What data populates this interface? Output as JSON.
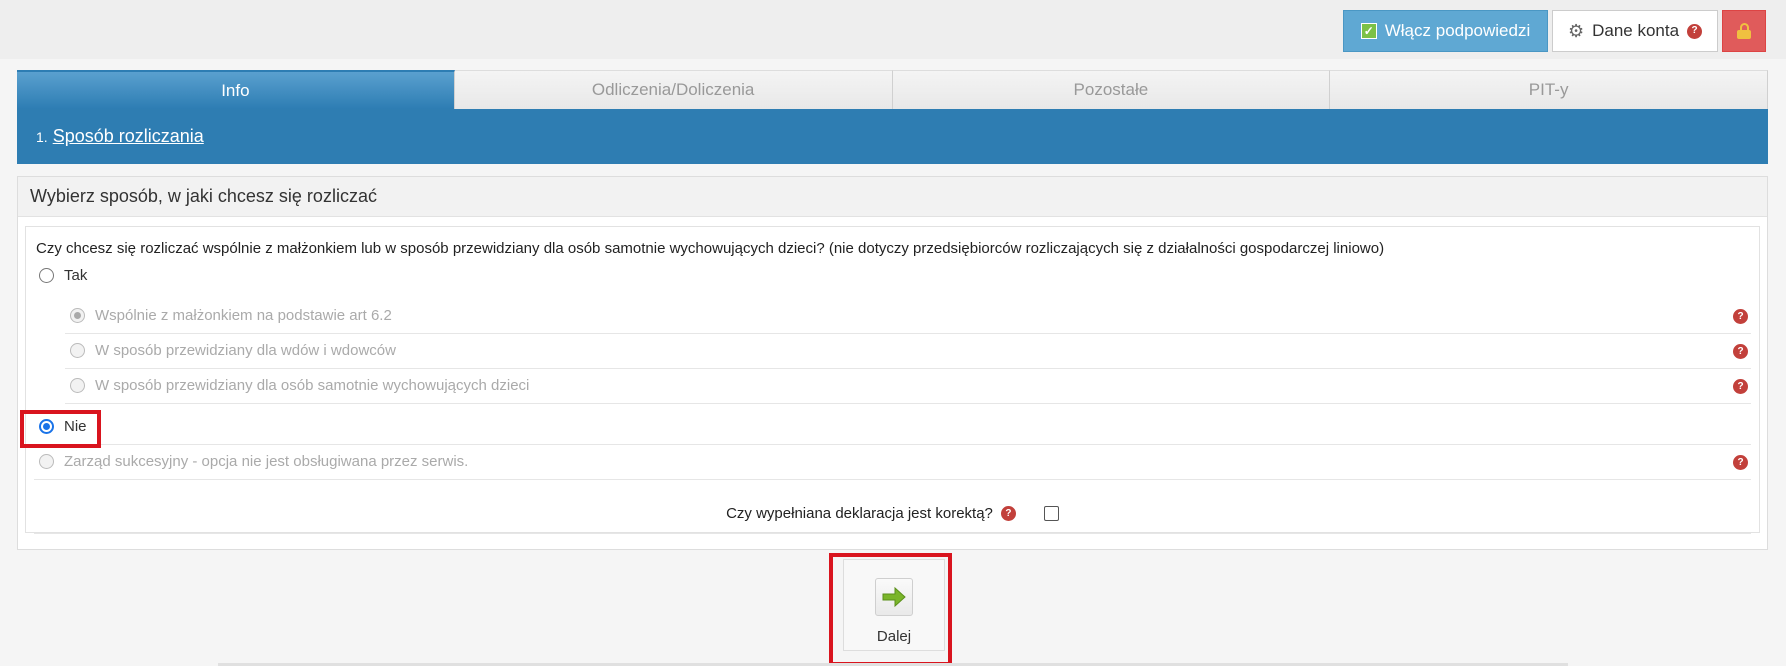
{
  "toolbar": {
    "hints_label": "Włącz podpowiedzi",
    "account_label": "Dane konta"
  },
  "tabs": [
    {
      "label": "Info"
    },
    {
      "label": "Odliczenia/Doliczenia"
    },
    {
      "label": "Pozostałe"
    },
    {
      "label": "PIT-y"
    }
  ],
  "step": {
    "number": "1.",
    "label": "Sposób rozliczania"
  },
  "panel": {
    "title": "Wybierz sposób, w jaki chcesz się rozliczać",
    "question": "Czy chcesz się rozliczać wspólnie z małżonkiem lub w sposób przewidziany dla osób samotnie wychowujących dzieci? (nie dotyczy przedsiębiorców rozliczających się z działalności gospodarczej liniowo)",
    "option_yes": "Tak",
    "sub_options": [
      {
        "label": "Wspólnie z małżonkiem na podstawie art 6.2"
      },
      {
        "label": "W sposób przewidziany dla wdów i wdowców"
      },
      {
        "label": "W sposób przewidziany dla osób samotnie wychowujących dzieci"
      }
    ],
    "option_no": "Nie",
    "option_succession": "Zarząd sukcesyjny - opcja nie jest obsługiwana przez serwis.",
    "correction_question": "Czy wypełniana deklaracja jest korektą?"
  },
  "next": {
    "label": "Dalej"
  },
  "help_glyph": "?",
  "colors": {
    "accent": "#2e7db2",
    "highlight": "#d9141e",
    "hints_button": "#5fa8d3",
    "lock_button": "#e05b5b"
  }
}
